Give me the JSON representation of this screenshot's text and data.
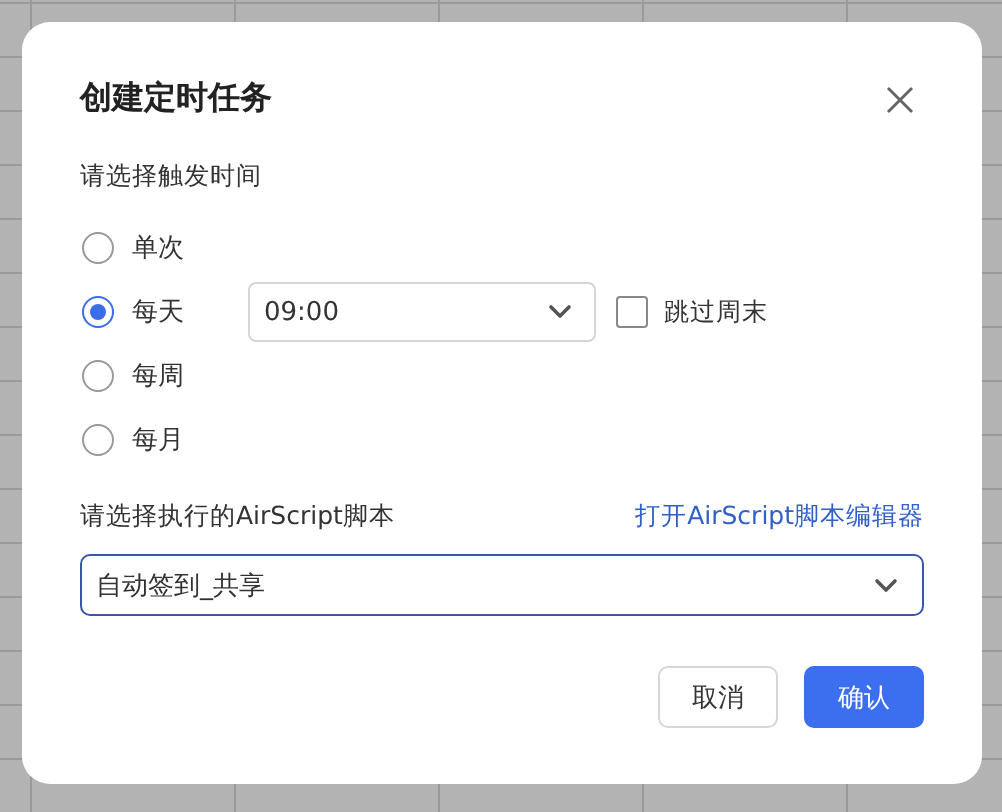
{
  "dialog": {
    "title": "创建定时任务",
    "trigger_label": "请选择触发时间",
    "frequency_options": [
      {
        "label": "单次",
        "selected": false
      },
      {
        "label": "每天",
        "selected": true,
        "time": "09:00",
        "skip_weekend": {
          "label": "跳过周末",
          "checked": false
        }
      },
      {
        "label": "每周",
        "selected": false
      },
      {
        "label": "每月",
        "selected": false
      }
    ],
    "script_label": "请选择执行的AirScript脚本",
    "editor_link": "打开AirScript脚本编辑器",
    "script_select": {
      "value": "自动签到_共享"
    },
    "buttons": [
      {
        "label": "取消",
        "kind": "secondary"
      },
      {
        "label": "确认",
        "kind": "primary"
      }
    ]
  }
}
